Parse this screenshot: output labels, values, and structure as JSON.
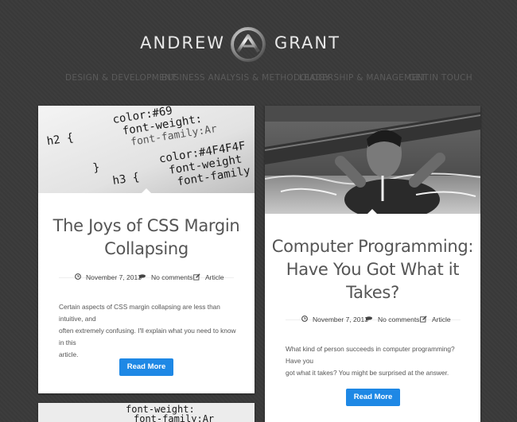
{
  "logo": {
    "left": "ANDREW",
    "right": "GRANT"
  },
  "nav": {
    "items": [
      {
        "label": "DESIGN & DEVELOPMENT"
      },
      {
        "label": "BUSINESS ANALYSIS & METHODOLOGY"
      },
      {
        "label": "LEADERSHIP & MANAGEMENT"
      },
      {
        "label": "GET IN TOUCH"
      }
    ]
  },
  "code": {
    "l1": "color:#69",
    "l2": "font-weight:",
    "l3": "font-family:Ar",
    "l4": "h2 {",
    "l5": "color:#4F4F4F",
    "l6": "font-weight",
    "l7": "font-family",
    "l8": "h3 {",
    "l9": "}"
  },
  "posts": [
    {
      "title_line1": "The Joys of CSS Margin",
      "title_line2": "Collapsing",
      "date": "November 7, 2013",
      "comments": "No comments",
      "category": "Article",
      "excerpt_line1": "Certain aspects of CSS margin collapsing are less than intuitive, and",
      "excerpt_line2": "often extremely confusing. I'll explain what you need to know in this",
      "excerpt_line3": "article.",
      "button": "Read More"
    },
    {
      "title_line1": "Computer Programming:",
      "title_line2": "Have You Got What it",
      "title_line3": "Takes?",
      "date": "November 7, 2013",
      "comments": "No comments",
      "category": "Article",
      "excerpt_line1": "What kind of person succeeds in computer programming? Have you",
      "excerpt_line2": "got what it takes? You might be surprised at the answer.",
      "button": "Read More"
    }
  ],
  "preview": {
    "code_line1": "font-weight:",
    "code_line2": "font-family:Ar"
  }
}
